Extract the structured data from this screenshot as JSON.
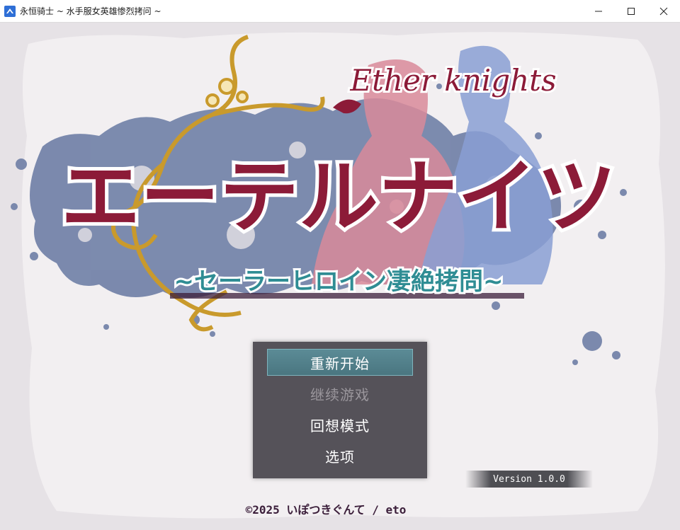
{
  "window": {
    "title": "永恒骑士 ~ 水手服女英雄惨烈拷问 ~",
    "controls": [
      "minimize-icon",
      "maximize-icon",
      "close-icon"
    ]
  },
  "logo": {
    "english_title": "Ether knights",
    "japanese_title": "エーテルナイツ",
    "subtitle": "~セーラーヒロイン凄絶拷問~"
  },
  "menu": {
    "items": [
      {
        "label": "重新开始",
        "state": "selected"
      },
      {
        "label": "继续游戏",
        "state": "disabled"
      },
      {
        "label": "回想模式",
        "state": "normal"
      },
      {
        "label": "选项",
        "state": "normal"
      }
    ]
  },
  "version": "Version 1.0.0",
  "copyright": "©2025 いぽつきぐんて / eto",
  "colors": {
    "menu_bg": "#322f37",
    "selected_bg": "#5b8b96",
    "disabled_text": "#9a969c",
    "title_red": "#8c1b38",
    "subtitle_teal": "#2f8d94",
    "ink_blue": "#6f7fa6"
  }
}
